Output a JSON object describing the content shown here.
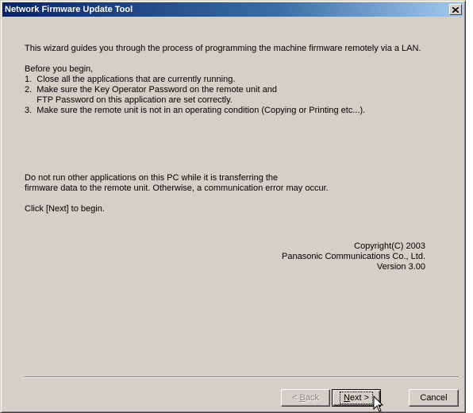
{
  "window": {
    "title": "Network Firmware Update Tool"
  },
  "content": {
    "intro": "This wizard guides you through the process of programming the machine firmware remotely via a LAN.",
    "before": "Before you begin,",
    "steps": [
      "1.  Close all the applications that are currently running.",
      "2.  Make sure the Key Operator Password on the remote unit and",
      "     FTP Password on this application are set correctly.",
      "3.  Make sure the remote unit is not in an operating condition (Copying or Printing etc...)."
    ],
    "warning_line1": "Do not run other applications on this PC while it is transferring the",
    "warning_line2": "firmware data to the remote unit. Otherwise, a communication error may occur.",
    "click_next": "Click [Next] to begin."
  },
  "copyright": {
    "line1": "Copyright(C) 2003",
    "line2": "Panasonic Communications Co., Ltd.",
    "line3": "Version 3.00"
  },
  "buttons": {
    "back_prefix": "< ",
    "back_accel": "B",
    "back_rest": "ack",
    "next_accel": "N",
    "next_rest": "ext >",
    "cancel": "Cancel"
  },
  "icons": {
    "close": "close-icon",
    "cursor": "mouse-pointer-icon"
  }
}
